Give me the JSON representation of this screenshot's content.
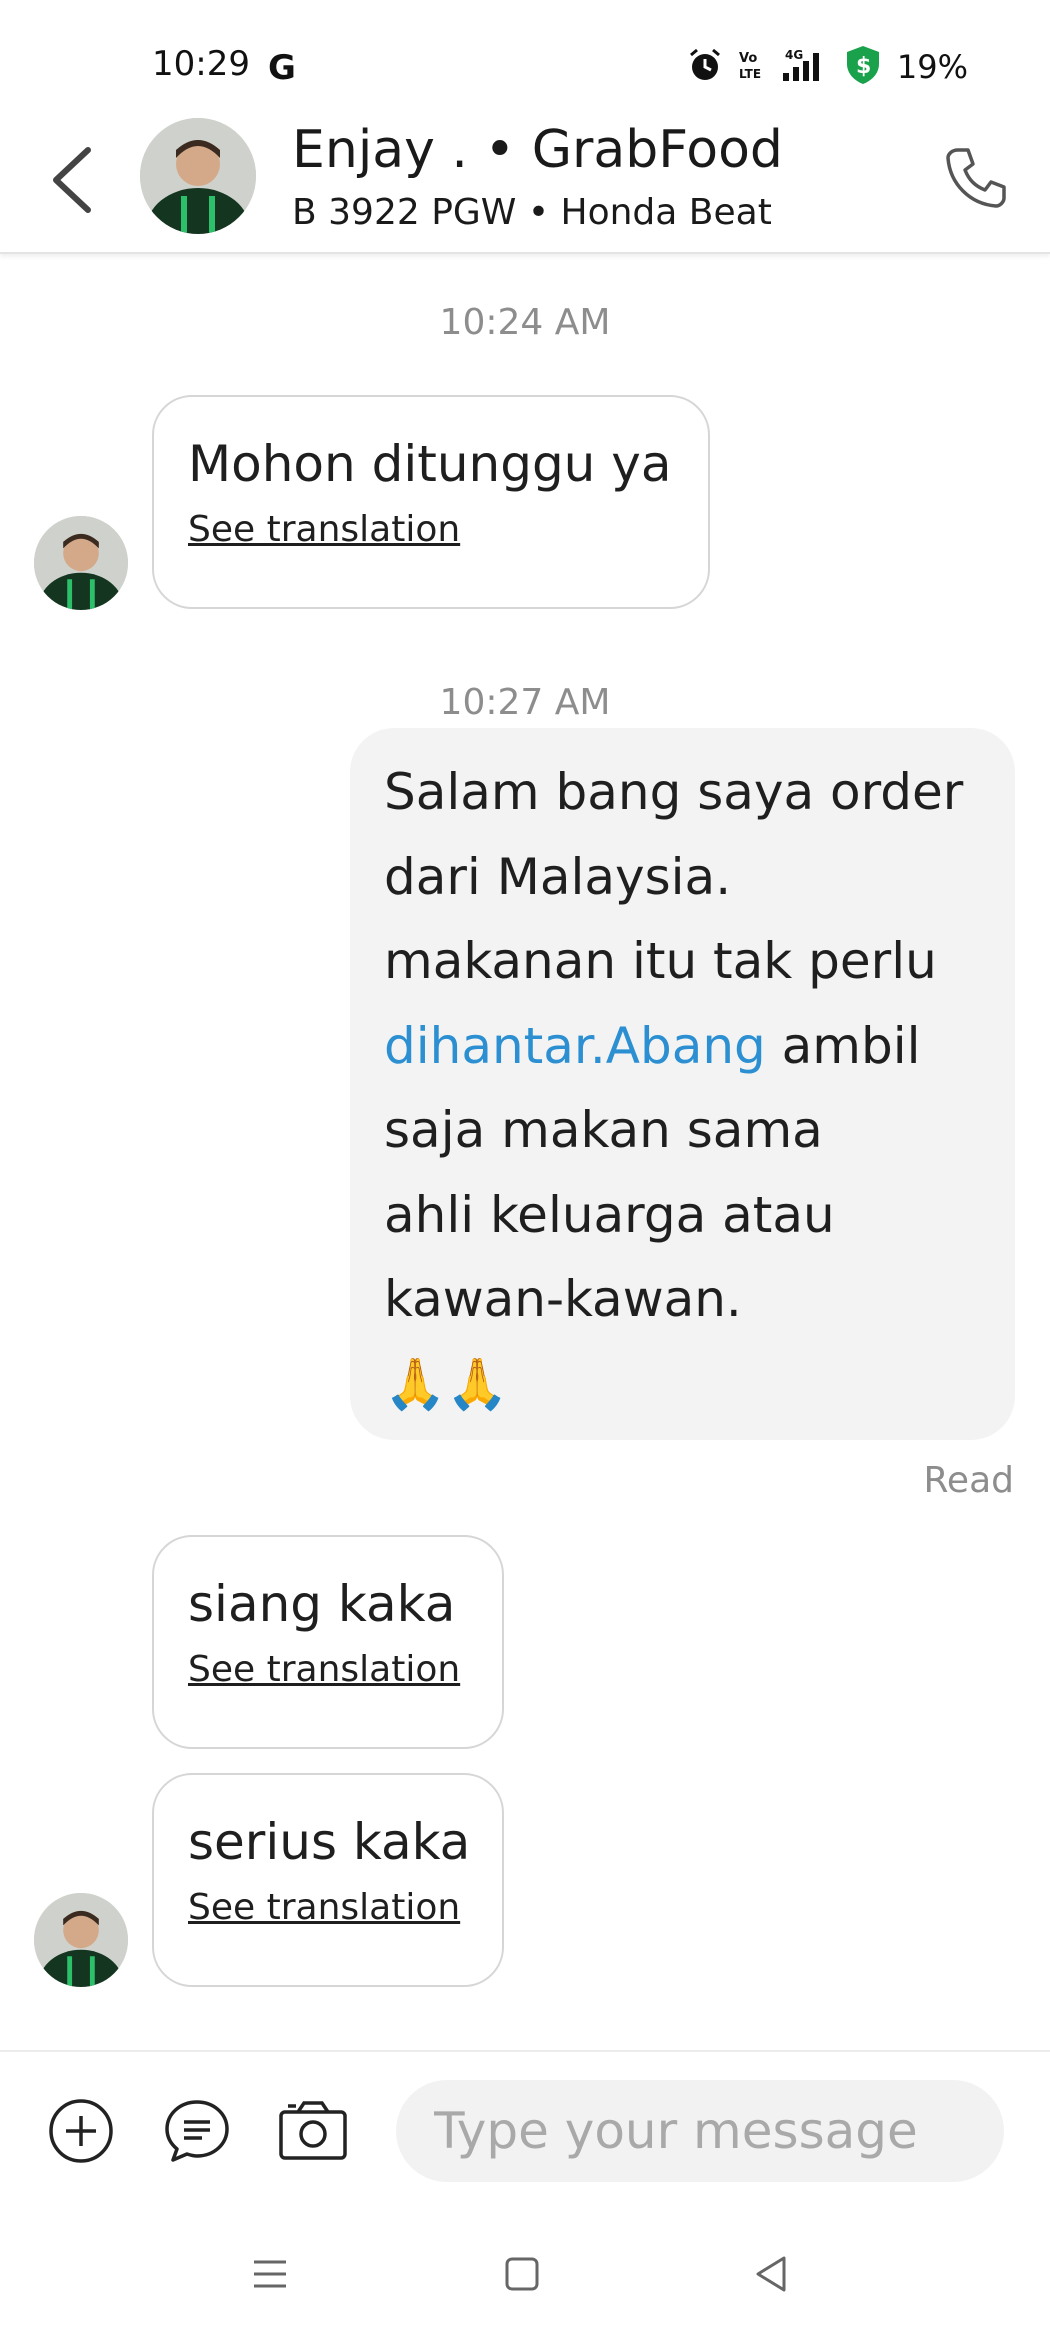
{
  "status_bar": {
    "time": "10:29",
    "carrier_icon": "google-g-icon",
    "battery": "19%",
    "icons": [
      "alarm-icon",
      "volte-icon",
      "4g-signal-icon",
      "shield-dollar-icon",
      "battery-icon"
    ]
  },
  "header": {
    "driver_name": "Enjay . • GrabFood",
    "vehicle": "B 3922 PGW • Honda Beat",
    "back_icon": "back-chevron-icon",
    "call_icon": "phone-icon"
  },
  "messages": [
    {
      "type": "timestamp",
      "text": "10:24 AM"
    },
    {
      "type": "incoming",
      "text": "Mohon ditunggu ya",
      "translate_label": "See translation"
    },
    {
      "type": "timestamp",
      "text": "10:27 AM"
    },
    {
      "type": "outgoing",
      "lines": [
        "Salam bang saya order",
        "dari Malaysia.",
        "makanan itu tak perlu",
        "ambil",
        "saja makan sama",
        "ahli keluarga atau",
        "kawan-kawan."
      ],
      "link_text": "dihantar.Abang",
      "emoji": "🙏🙏",
      "status": "Read"
    },
    {
      "type": "incoming",
      "text": "siang kaka",
      "translate_label": "See translation"
    },
    {
      "type": "incoming",
      "text": "serius kaka",
      "translate_label": "See translation"
    }
  ],
  "input_bar": {
    "placeholder": "Type your message",
    "value": "",
    "icons": [
      "add-circle-icon",
      "quick-reply-icon",
      "camera-icon"
    ]
  },
  "nav_bar": {
    "icons": [
      "menu-nav-icon",
      "home-nav-icon",
      "back-nav-icon"
    ]
  },
  "colors": {
    "link": "#2b8fd1",
    "outgoing_bubble": "#f3f3f3",
    "incoming_border": "#d6d6d6",
    "timestamp": "#8d8d8d",
    "grab_green": "#1aa14c"
  }
}
